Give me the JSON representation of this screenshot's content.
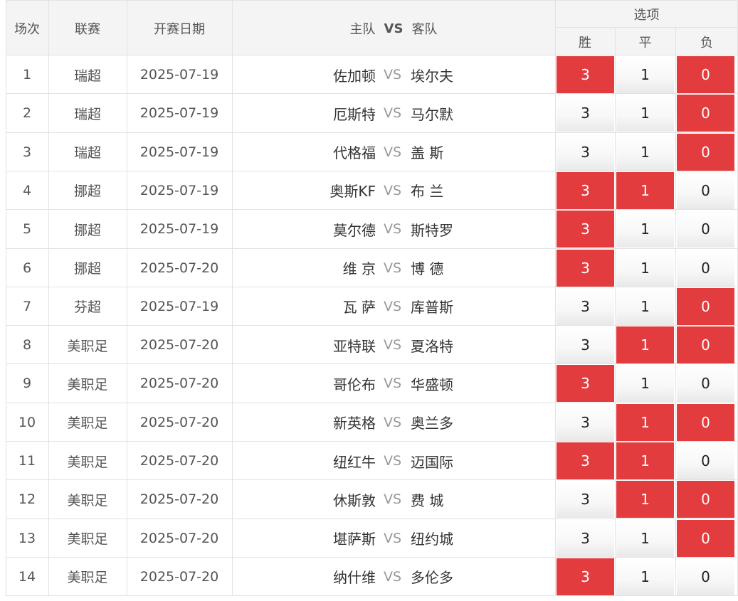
{
  "header": {
    "col_no": "场次",
    "col_league": "联赛",
    "col_date": "开赛日期",
    "col_home": "主队",
    "col_vs": "VS",
    "col_away": "客队",
    "col_options": "选项",
    "opt_win": "胜",
    "opt_draw": "平",
    "opt_lose": "负"
  },
  "accent_color": "#e23c3f",
  "matches": [
    {
      "no": "1",
      "league": "瑞超",
      "date": "2025-07-19",
      "home": "佐加顿",
      "vs": "VS",
      "away": "埃尔夫",
      "win": "3",
      "draw": "1",
      "lose": "0",
      "win_sel": true,
      "draw_sel": false,
      "lose_sel": true
    },
    {
      "no": "2",
      "league": "瑞超",
      "date": "2025-07-19",
      "home": "厄斯特",
      "vs": "VS",
      "away": "马尔默",
      "win": "3",
      "draw": "1",
      "lose": "0",
      "win_sel": false,
      "draw_sel": false,
      "lose_sel": true
    },
    {
      "no": "3",
      "league": "瑞超",
      "date": "2025-07-19",
      "home": "代格福",
      "vs": "VS",
      "away": "盖 斯",
      "win": "3",
      "draw": "1",
      "lose": "0",
      "win_sel": false,
      "draw_sel": false,
      "lose_sel": true
    },
    {
      "no": "4",
      "league": "挪超",
      "date": "2025-07-19",
      "home": "奥斯KF",
      "vs": "VS",
      "away": "布 兰",
      "win": "3",
      "draw": "1",
      "lose": "0",
      "win_sel": true,
      "draw_sel": true,
      "lose_sel": false
    },
    {
      "no": "5",
      "league": "挪超",
      "date": "2025-07-19",
      "home": "莫尔德",
      "vs": "VS",
      "away": "斯特罗",
      "win": "3",
      "draw": "1",
      "lose": "0",
      "win_sel": true,
      "draw_sel": false,
      "lose_sel": false
    },
    {
      "no": "6",
      "league": "挪超",
      "date": "2025-07-20",
      "home": "维 京",
      "vs": "VS",
      "away": "博 德",
      "win": "3",
      "draw": "1",
      "lose": "0",
      "win_sel": true,
      "draw_sel": false,
      "lose_sel": false
    },
    {
      "no": "7",
      "league": "芬超",
      "date": "2025-07-19",
      "home": "瓦 萨",
      "vs": "VS",
      "away": "库普斯",
      "win": "3",
      "draw": "1",
      "lose": "0",
      "win_sel": false,
      "draw_sel": false,
      "lose_sel": true
    },
    {
      "no": "8",
      "league": "美职足",
      "date": "2025-07-20",
      "home": "亚特联",
      "vs": "VS",
      "away": "夏洛特",
      "win": "3",
      "draw": "1",
      "lose": "0",
      "win_sel": false,
      "draw_sel": true,
      "lose_sel": true
    },
    {
      "no": "9",
      "league": "美职足",
      "date": "2025-07-20",
      "home": "哥伦布",
      "vs": "VS",
      "away": "华盛顿",
      "win": "3",
      "draw": "1",
      "lose": "0",
      "win_sel": true,
      "draw_sel": false,
      "lose_sel": false
    },
    {
      "no": "10",
      "league": "美职足",
      "date": "2025-07-20",
      "home": "新英格",
      "vs": "VS",
      "away": "奥兰多",
      "win": "3",
      "draw": "1",
      "lose": "0",
      "win_sel": false,
      "draw_sel": true,
      "lose_sel": true
    },
    {
      "no": "11",
      "league": "美职足",
      "date": "2025-07-20",
      "home": "纽红牛",
      "vs": "VS",
      "away": "迈国际",
      "win": "3",
      "draw": "1",
      "lose": "0",
      "win_sel": true,
      "draw_sel": true,
      "lose_sel": false
    },
    {
      "no": "12",
      "league": "美职足",
      "date": "2025-07-20",
      "home": "休斯敦",
      "vs": "VS",
      "away": "费 城",
      "win": "3",
      "draw": "1",
      "lose": "0",
      "win_sel": false,
      "draw_sel": true,
      "lose_sel": true
    },
    {
      "no": "13",
      "league": "美职足",
      "date": "2025-07-20",
      "home": "堪萨斯",
      "vs": "VS",
      "away": "纽约城",
      "win": "3",
      "draw": "1",
      "lose": "0",
      "win_sel": false,
      "draw_sel": false,
      "lose_sel": true
    },
    {
      "no": "14",
      "league": "美职足",
      "date": "2025-07-20",
      "home": "纳什维",
      "vs": "VS",
      "away": "多伦多",
      "win": "3",
      "draw": "1",
      "lose": "0",
      "win_sel": true,
      "draw_sel": false,
      "lose_sel": false
    }
  ]
}
